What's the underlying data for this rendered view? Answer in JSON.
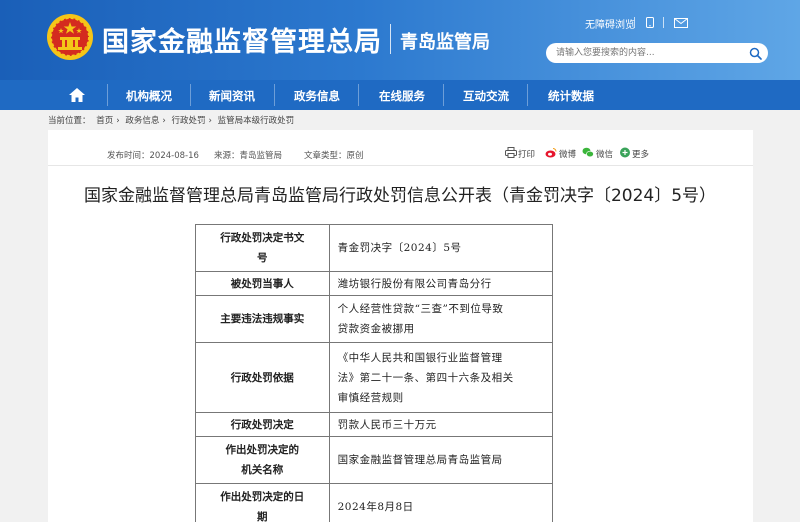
{
  "header": {
    "site_title": "国家金融监督管理总局",
    "site_subtitle": "青岛监管局",
    "accessibility_link": "无障碍浏览",
    "search_placeholder": "请输入您要搜索的内容..."
  },
  "nav": {
    "items": [
      {
        "label": "机构概况"
      },
      {
        "label": "新闻资讯"
      },
      {
        "label": "政务信息"
      },
      {
        "label": "在线服务"
      },
      {
        "label": "互动交流"
      },
      {
        "label": "统计数据"
      }
    ]
  },
  "breadcrumb": {
    "prefix": "当前位置：",
    "items": [
      "首页",
      "政务信息",
      "行政处罚",
      "监管局本级行政处罚"
    ]
  },
  "meta": {
    "publish_time": "发布时间：2024-08-16",
    "source": "来源：青岛监管局",
    "doc_type": "文章类型：原创"
  },
  "share": {
    "print": "打印",
    "weibo": "微博",
    "wechat": "微信",
    "more": "更多"
  },
  "document": {
    "title": "国家金融监督管理总局青岛监管局行政处罚信息公开表（青金罚决字〔2024〕5号）",
    "rows": [
      {
        "key": [
          "行政处罚决定书文",
          "号"
        ],
        "value": [
          "青金罚决字〔2024〕5号"
        ]
      },
      {
        "key": [
          "被处罚当事人"
        ],
        "value": [
          "潍坊银行股份有限公司青岛分行"
        ]
      },
      {
        "key": [
          "主要违法违规事实"
        ],
        "value": [
          "个人经营性贷款“三查”不到位导致",
          "贷款资金被挪用"
        ]
      },
      {
        "key": [
          "行政处罚依据"
        ],
        "value": [
          "《中华人民共和国银行业监督管理",
          "法》第二十一条、第四十六条及相关",
          "审慎经营规则"
        ]
      },
      {
        "key": [
          "行政处罚决定"
        ],
        "value": [
          "罚款人民币三十万元"
        ]
      },
      {
        "key": [
          "作出处罚决定的",
          "机关名称"
        ],
        "value": [
          "国家金融监督管理总局青岛监管局"
        ]
      },
      {
        "key": [
          "作出处罚决定的日",
          "期"
        ],
        "value": [
          "2024年8月8日"
        ]
      }
    ]
  },
  "colors": {
    "header_start": "#1a5fb8",
    "nav_bg": "#1f6ac3",
    "emblem_red": "#d42a1f",
    "emblem_gold": "#f5c518"
  }
}
